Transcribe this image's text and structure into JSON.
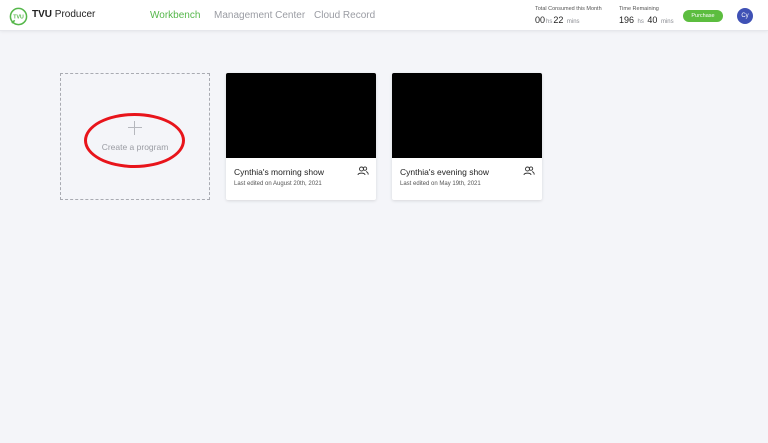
{
  "header": {
    "app_name_bold": "TVU",
    "app_name_rest": " Producer",
    "logo_text": "TVU",
    "nav": {
      "workbench": "Workbench",
      "management": "Management Center",
      "cloud": "Cloud Record"
    },
    "consumed": {
      "label": "Total Consumed this Month",
      "hours": "00",
      "hours_unit": "hs",
      "mins": "22",
      "mins_unit": "mins"
    },
    "remaining": {
      "label": "Time Remaining",
      "hours": "196",
      "hours_unit": "hs",
      "mins": "40",
      "mins_unit": "mins"
    },
    "purchase_label": "Purchase",
    "avatar_initials": "Cy",
    "colors": {
      "accent_green": "#55b74a",
      "purchase_green": "#5cbd3f",
      "avatar_blue": "#3f51b5"
    }
  },
  "create_card": {
    "label": "Create a program",
    "annotation_color": "#e8141b"
  },
  "programs": [
    {
      "title": "Cynthia's morning show",
      "last_edited": "Last edited on August 20th, 2021",
      "icon": "users-icon"
    },
    {
      "title": "Cynthia's evening show",
      "last_edited": "Last edited on May 19th, 2021",
      "icon": "users-icon"
    }
  ]
}
